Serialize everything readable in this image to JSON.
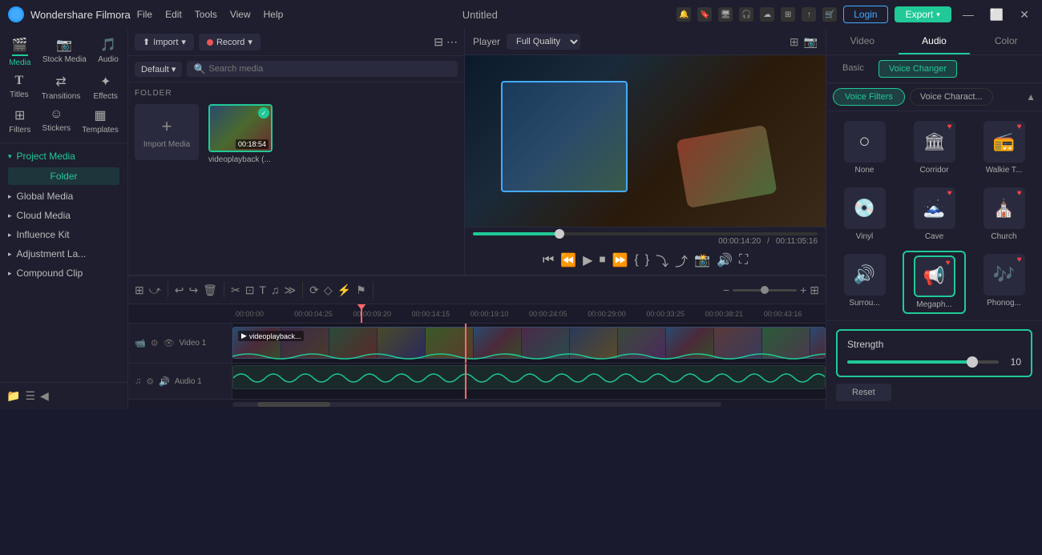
{
  "app": {
    "name": "Wondershare Filmora",
    "title": "Untitled",
    "menu": [
      "File",
      "Edit",
      "Tools",
      "View",
      "Help"
    ]
  },
  "titlebar": {
    "login": "Login",
    "export": "Export",
    "icons": [
      "notification",
      "bookmark",
      "monitor",
      "headphones",
      "cloud",
      "grid",
      "share",
      "cart"
    ]
  },
  "toolbar": {
    "items": [
      {
        "id": "media",
        "icon": "🎬",
        "label": "Media",
        "active": true
      },
      {
        "id": "stock",
        "icon": "📷",
        "label": "Stock Media"
      },
      {
        "id": "audio",
        "icon": "🎵",
        "label": "Audio"
      },
      {
        "id": "titles",
        "icon": "T",
        "label": "Titles"
      },
      {
        "id": "transitions",
        "icon": "⧖",
        "label": "Transitions"
      },
      {
        "id": "effects",
        "icon": "✦",
        "label": "Effects"
      },
      {
        "id": "filters",
        "icon": "⊞",
        "label": "Filters"
      },
      {
        "id": "stickers",
        "icon": "☺",
        "label": "Stickers"
      },
      {
        "id": "templates",
        "icon": "▦",
        "label": "Templates"
      }
    ]
  },
  "left_panel": {
    "tree_items": [
      {
        "label": "Project Media",
        "active": true
      },
      {
        "label": "Global Media"
      },
      {
        "label": "Cloud Media"
      },
      {
        "label": "Influence Kit"
      },
      {
        "label": "Adjustment La..."
      },
      {
        "label": "Compound Clip"
      }
    ],
    "folder_label": "Folder"
  },
  "media_library": {
    "import_label": "Import",
    "record_label": "Record",
    "default_label": "Default",
    "search_placeholder": "Search media",
    "folder_header": "FOLDER",
    "import_media_label": "Import Media",
    "file": {
      "name": "videoplayback (...",
      "duration": "00:18:54"
    }
  },
  "preview": {
    "player_label": "Player",
    "quality": "Full Quality",
    "current_time": "00:00:14:20",
    "total_time": "00:11:05:16",
    "progress_pct": 25
  },
  "right_panel": {
    "tabs": [
      "Video",
      "Audio",
      "Color"
    ],
    "active_tab": "Audio",
    "sub_tabs": [
      "Basic",
      "Voice Changer"
    ],
    "active_sub_tab": "Voice Changer",
    "filter_btn": "Voice Filters",
    "voicechar_btn": "Voice Charact...",
    "voice_filters": [
      {
        "id": "none",
        "icon": "○",
        "label": "None",
        "heart": false
      },
      {
        "id": "corridor",
        "icon": "🏛",
        "label": "Corridor",
        "heart": true
      },
      {
        "id": "walkie",
        "icon": "📻",
        "label": "Walkie T...",
        "heart": true
      },
      {
        "id": "vinyl",
        "icon": "💿",
        "label": "Vinyl",
        "heart": false
      },
      {
        "id": "cave",
        "icon": "🗻",
        "label": "Cave",
        "heart": true
      },
      {
        "id": "church",
        "icon": "⛪",
        "label": "Church",
        "heart": true
      },
      {
        "id": "surround",
        "icon": "🔊",
        "label": "Surrou...",
        "heart": false
      },
      {
        "id": "megaphone",
        "icon": "📢",
        "label": "Megaph...",
        "heart": true,
        "selected": true
      },
      {
        "id": "phonograph",
        "icon": "🎶",
        "label": "Phonog...",
        "heart": true
      }
    ],
    "strength": {
      "label": "Strength",
      "value": 10,
      "max": 100,
      "pct": 85
    },
    "reset_btn": "Reset"
  },
  "timeline": {
    "ruler_marks": [
      "00:00:00",
      "00:00:04:25",
      "00:00:09:20",
      "00:00:14:15",
      "00:00:19:10",
      "00:00:24:05",
      "00:00:29:00",
      "00:00:33:25",
      "00:00:38:21",
      "00:00:43:16"
    ],
    "tracks": [
      {
        "id": "video1",
        "type": "video",
        "label": "Video 1"
      },
      {
        "id": "audio1",
        "type": "audio",
        "label": "Audio 1"
      }
    ],
    "clip_name": "videoplayback..."
  }
}
